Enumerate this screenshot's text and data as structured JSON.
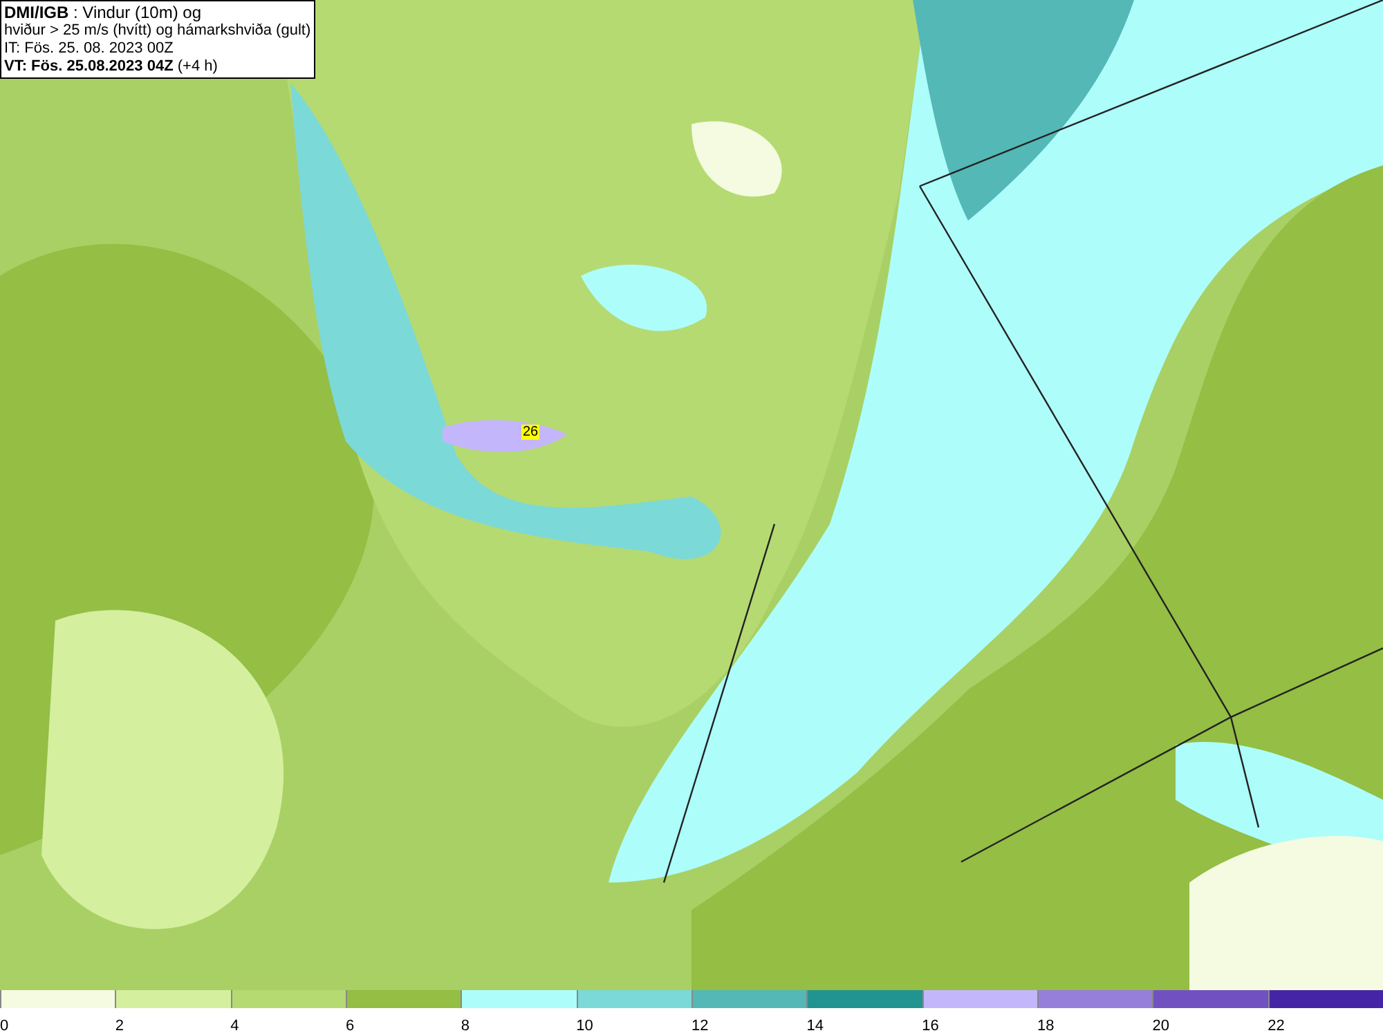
{
  "title_box": {
    "lines": [
      "**DMI/IGB** : Vindur (10m) og",
      "hviður > 25 m/s (hvítt) og hámarkshviða (gult)",
      "IT: Fös. 25. 08. 2023 00Z",
      "**VT: Fös. 25.08.2023 04Z** (+4 h)"
    ]
  },
  "map": {
    "gust_marker": "26"
  },
  "legend": {
    "bins": [
      {
        "color": "#f4fbe0",
        "label": "0"
      },
      {
        "color": "#d4ef9e",
        "label": "2"
      },
      {
        "color": "#b5da72",
        "label": "4"
      },
      {
        "color": "#94be44",
        "label": "6"
      },
      {
        "color": "#adfdfb",
        "label": "8"
      },
      {
        "color": "#7bd9d8",
        "label": "10"
      },
      {
        "color": "#54b8b6",
        "label": "12"
      },
      {
        "color": "#219391",
        "label": "14"
      },
      {
        "color": "#c4b6fb",
        "label": "16"
      },
      {
        "color": "#967fdb",
        "label": "18"
      },
      {
        "color": "#7151c2",
        "label": "20"
      },
      {
        "color": "#4525a6",
        "label": "22"
      }
    ]
  }
}
